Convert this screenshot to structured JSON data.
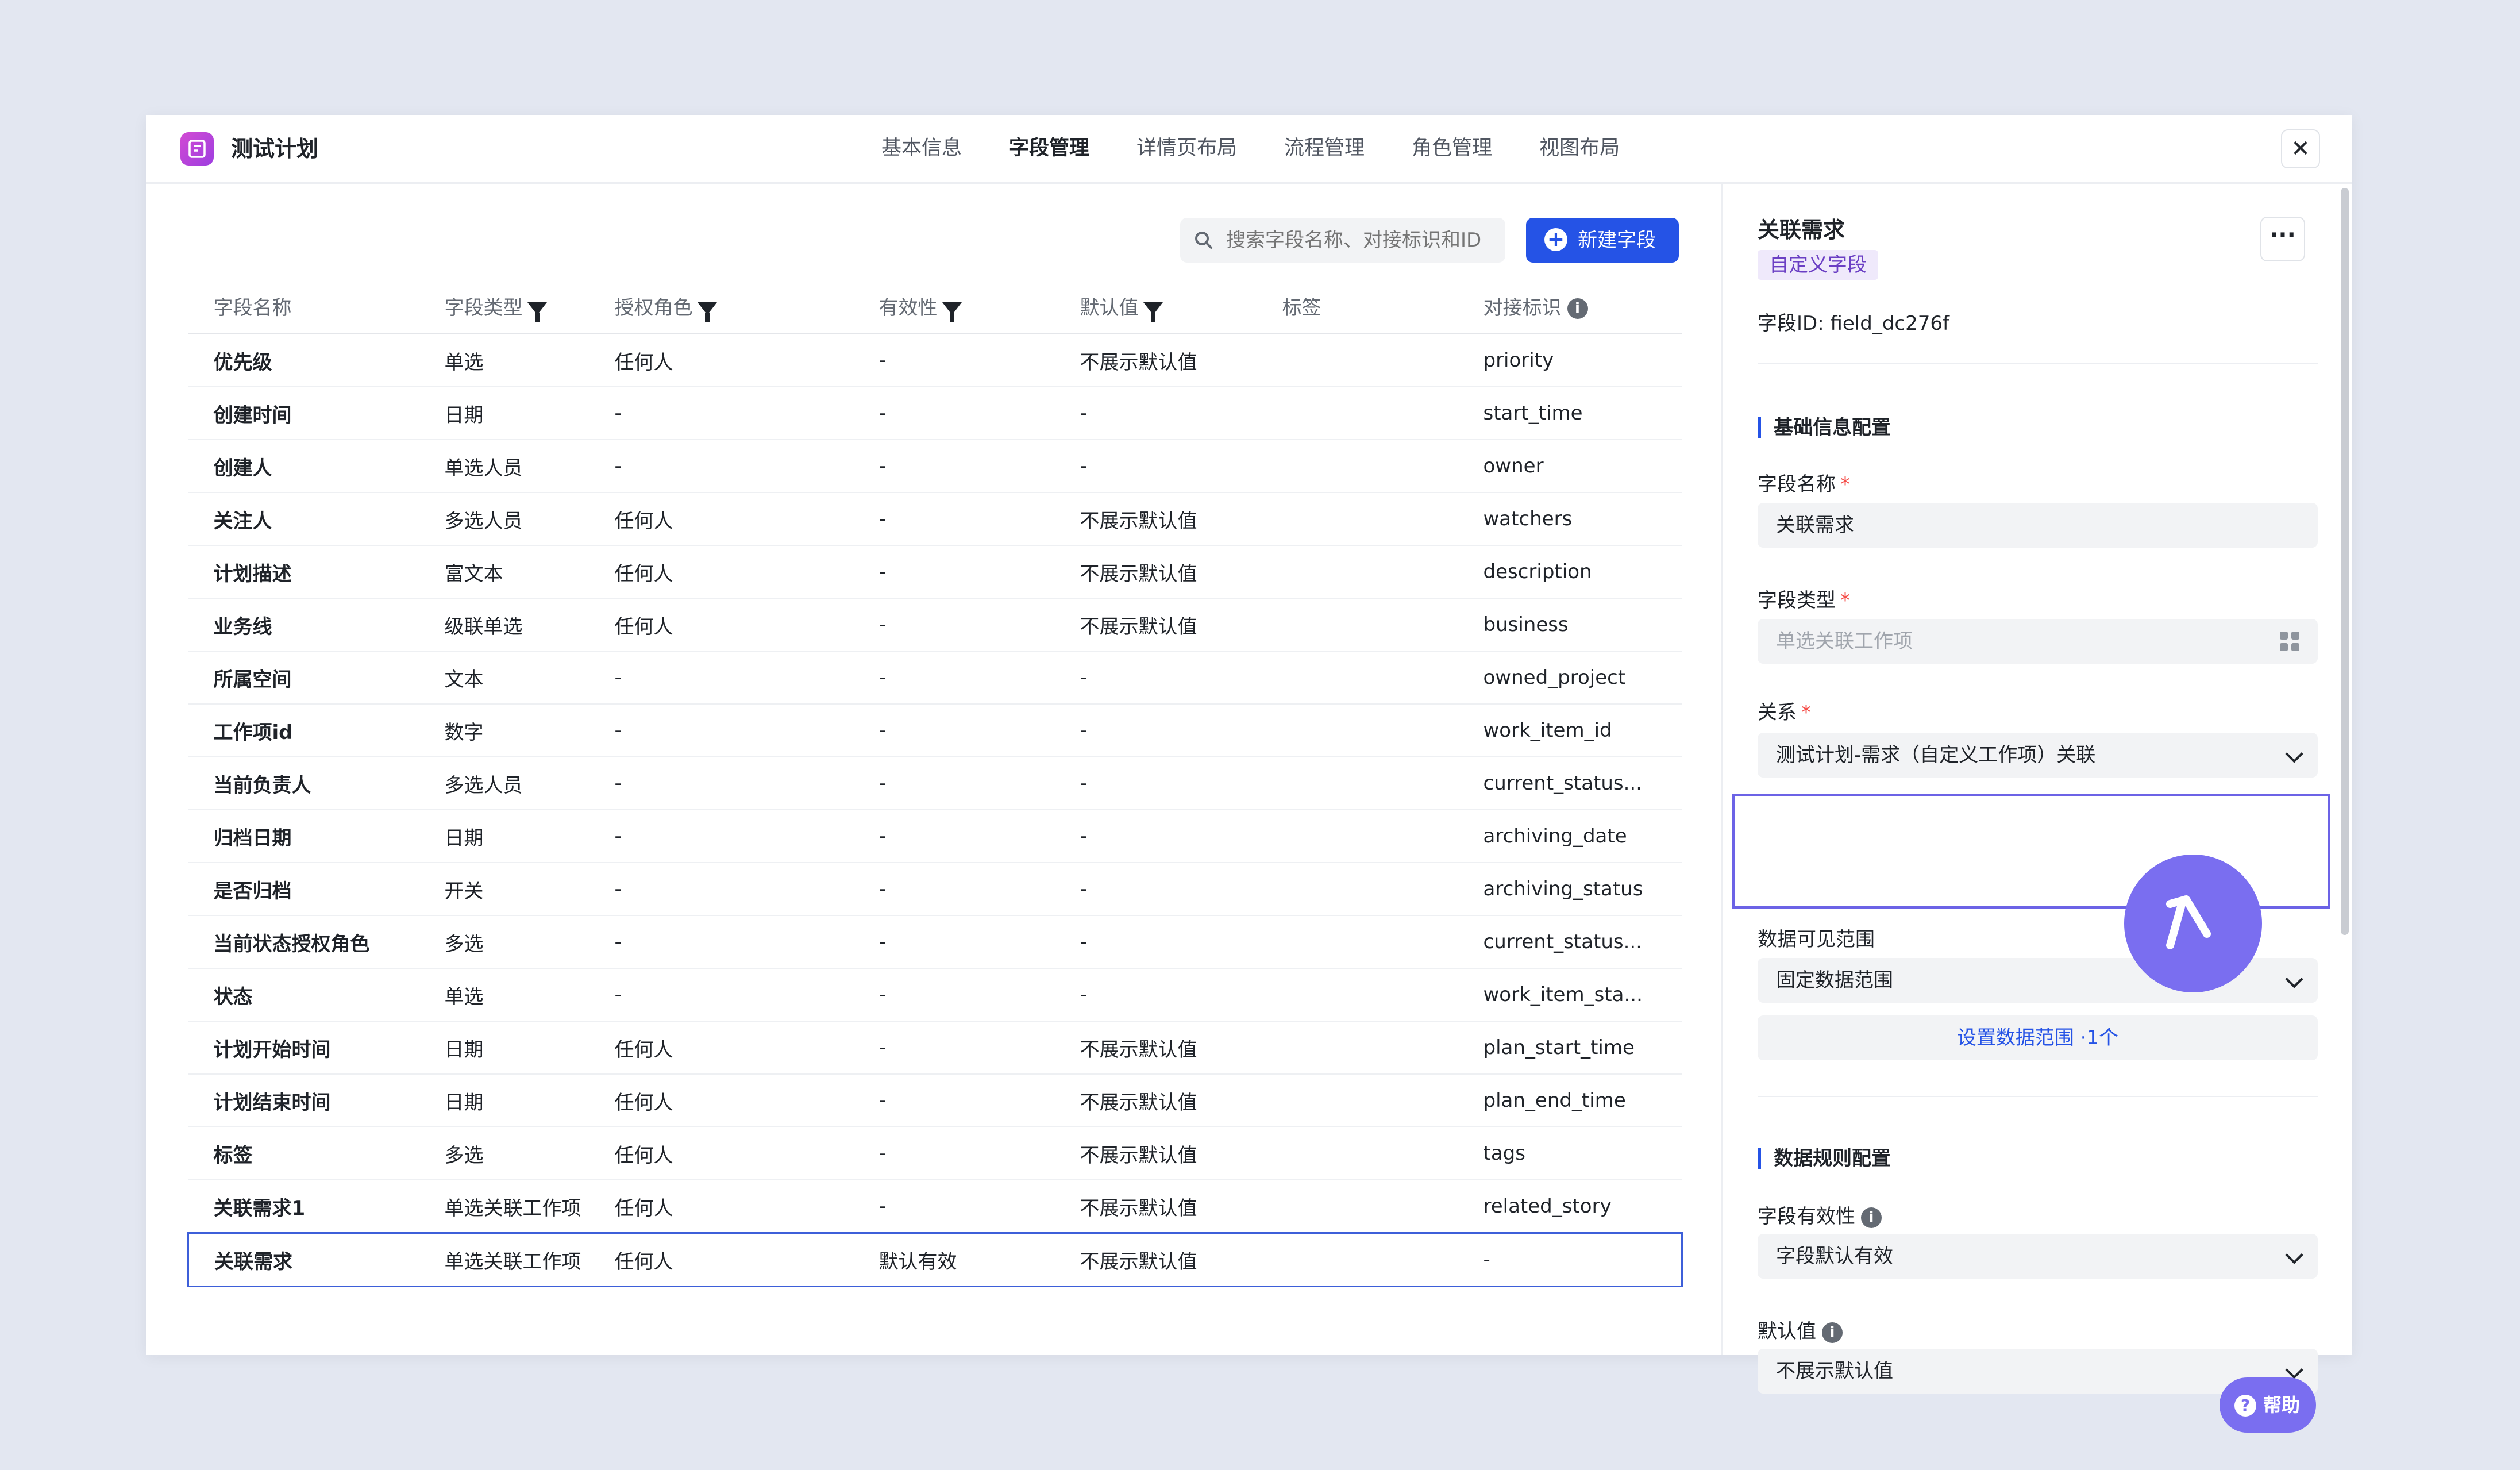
{
  "app": {
    "title": "测试计划"
  },
  "tabs": [
    {
      "label": "基本信息",
      "active": false
    },
    {
      "label": "字段管理",
      "active": true
    },
    {
      "label": "详情页布局",
      "active": false
    },
    {
      "label": "流程管理",
      "active": false
    },
    {
      "label": "角色管理",
      "active": false
    },
    {
      "label": "视图布局",
      "active": false
    }
  ],
  "close_label": "✕",
  "toolbar": {
    "search_placeholder": "搜索字段名称、对接标识和ID",
    "new_field_label": "新建字段"
  },
  "table": {
    "headers": [
      "字段名称",
      "字段类型",
      "授权角色",
      "有效性",
      "默认值",
      "标签",
      "对接标识"
    ],
    "rows": [
      [
        "优先级",
        "单选",
        "任何人",
        "-",
        "不展示默认值",
        "",
        "priority"
      ],
      [
        "创建时间",
        "日期",
        "-",
        "-",
        "-",
        "",
        "start_time"
      ],
      [
        "创建人",
        "单选人员",
        "-",
        "-",
        "-",
        "",
        "owner"
      ],
      [
        "关注人",
        "多选人员",
        "任何人",
        "-",
        "不展示默认值",
        "",
        "watchers"
      ],
      [
        "计划描述",
        "富文本",
        "任何人",
        "-",
        "不展示默认值",
        "",
        "description"
      ],
      [
        "业务线",
        "级联单选",
        "任何人",
        "-",
        "不展示默认值",
        "",
        "business"
      ],
      [
        "所属空间",
        "文本",
        "-",
        "-",
        "-",
        "",
        "owned_project"
      ],
      [
        "工作项id",
        "数字",
        "-",
        "-",
        "-",
        "",
        "work_item_id"
      ],
      [
        "当前负责人",
        "多选人员",
        "-",
        "-",
        "-",
        "",
        "current_status..."
      ],
      [
        "归档日期",
        "日期",
        "-",
        "-",
        "-",
        "",
        "archiving_date"
      ],
      [
        "是否归档",
        "开关",
        "-",
        "-",
        "-",
        "",
        "archiving_status"
      ],
      [
        "当前状态授权角色",
        "多选",
        "-",
        "-",
        "-",
        "",
        "current_status..."
      ],
      [
        "状态",
        "单选",
        "-",
        "-",
        "-",
        "",
        "work_item_sta..."
      ],
      [
        "计划开始时间",
        "日期",
        "任何人",
        "-",
        "不展示默认值",
        "",
        "plan_start_time"
      ],
      [
        "计划结束时间",
        "日期",
        "任何人",
        "-",
        "不展示默认值",
        "",
        "plan_end_time"
      ],
      [
        "标签",
        "多选",
        "任何人",
        "-",
        "不展示默认值",
        "",
        "tags"
      ],
      [
        "关联需求1",
        "单选关联工作项",
        "任何人",
        "-",
        "不展示默认值",
        "",
        "related_story"
      ],
      [
        "关联需求",
        "单选关联工作项",
        "任何人",
        "默认有效",
        "不展示默认值",
        "",
        "-"
      ]
    ],
    "selected_row": 17
  },
  "panel": {
    "title": "关联需求",
    "badge": "自定义字段",
    "more_label": "···",
    "field_id": "字段ID:  field_dc276f",
    "basic_section": "基础信息配置",
    "name_label": "字段名称",
    "name_value": "关联需求",
    "type_label": "字段类型",
    "type_value": "单选关联工作项",
    "relation_label": "关系",
    "relation_value": "测试计划-需求（自定义工作项）关联",
    "scope_label": "数据可见范围",
    "scope_value": "固定数据范围",
    "scope_link": "设置数据范围 ·1个",
    "rules_section": "数据规则配置",
    "validity_label": "字段有效性",
    "validity_value": "字段默认有效",
    "default_label": "默认值",
    "default_value": "不展示默认值",
    "required_mark": "*"
  },
  "help": {
    "label": "帮助",
    "icon": "?"
  },
  "colors": {
    "accent": "#2553e6",
    "purple": "#7a6ef0",
    "badge_bg": "#efe9fb"
  }
}
